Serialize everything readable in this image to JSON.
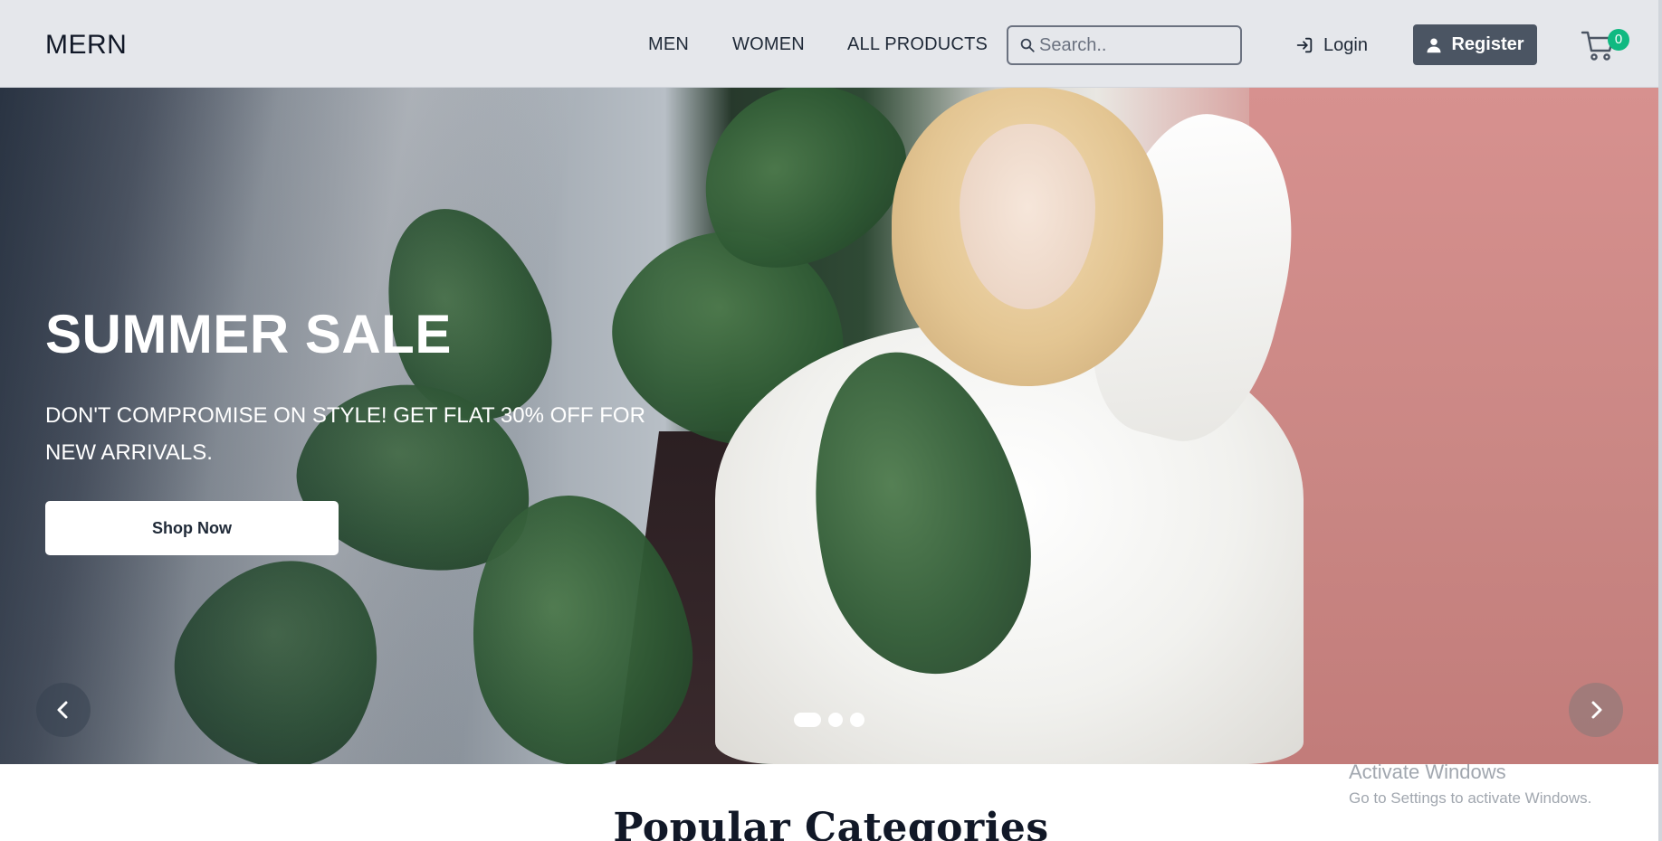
{
  "navbar": {
    "brand": "MERN",
    "links": [
      {
        "label": "MEN"
      },
      {
        "label": "WOMEN"
      },
      {
        "label": "ALL PRODUCTS"
      }
    ],
    "search": {
      "placeholder": "Search..",
      "value": ""
    },
    "login_label": "Login",
    "register_label": "Register",
    "cart_count": "0",
    "icons": {
      "search": "search-icon",
      "login": "login-arrow-icon",
      "register": "user-icon",
      "cart": "cart-icon"
    }
  },
  "hero": {
    "title": "SUMMER SALE",
    "subtitle": "DON'T COMPROMISE ON STYLE! GET FLAT 30% OFF FOR NEW ARRIVALS.",
    "cta_label": "Shop Now",
    "slides": 3,
    "active_slide": 1,
    "icons": {
      "prev": "chevron-left-icon",
      "next": "chevron-right-icon"
    }
  },
  "main": {
    "section_title": "Popular Categories"
  },
  "os_watermark": {
    "title": "Activate Windows",
    "subtitle": "Go to Settings to activate Windows."
  },
  "colors": {
    "navbar_bg": "#e5e7eb",
    "register_bg": "#4b5563",
    "cart_badge": "#10b981",
    "hero_text": "#ffffff"
  }
}
